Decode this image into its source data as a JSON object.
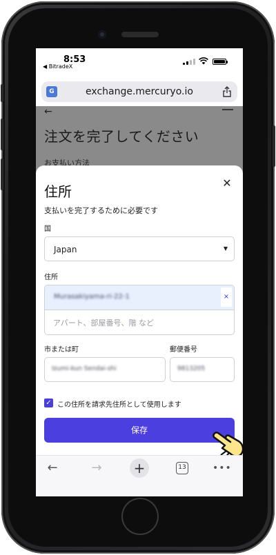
{
  "status_bar": {
    "time": "8:53",
    "back_app": "◀ BitradeX"
  },
  "browser": {
    "url": "exchange.mercuryo.io",
    "translate_icon_text": "G"
  },
  "background_page": {
    "back_arrow": "←",
    "title": "注文を完了してください",
    "subtitle": "お支払い方法"
  },
  "sheet": {
    "title": "住所",
    "close": "✕",
    "subtitle": "支払いを完了するために必要です",
    "country_label": "国",
    "country_value": "Japan",
    "address_label": "住所",
    "address_line1_value": "Murasakiyama-ri-22-1",
    "address_clear": "×",
    "address_line2_placeholder": "アパート、部屋番号、階 など",
    "city_label": "市または町",
    "city_value": "Izumi-kun Sendai-shi",
    "zip_label": "郵便番号",
    "zip_value": "9813205",
    "billing_checkbox_label": "この住所を請求先住所として使用します",
    "billing_checked": true,
    "save_label": "保存"
  },
  "toolbar": {
    "back": "←",
    "forward": "→",
    "new_tab": "+",
    "tab_count": "13",
    "more": "•••"
  },
  "colors": {
    "primary": "#4b3fe0",
    "autofill": "#e8f0fe",
    "overlay": "#8a8a8a"
  }
}
